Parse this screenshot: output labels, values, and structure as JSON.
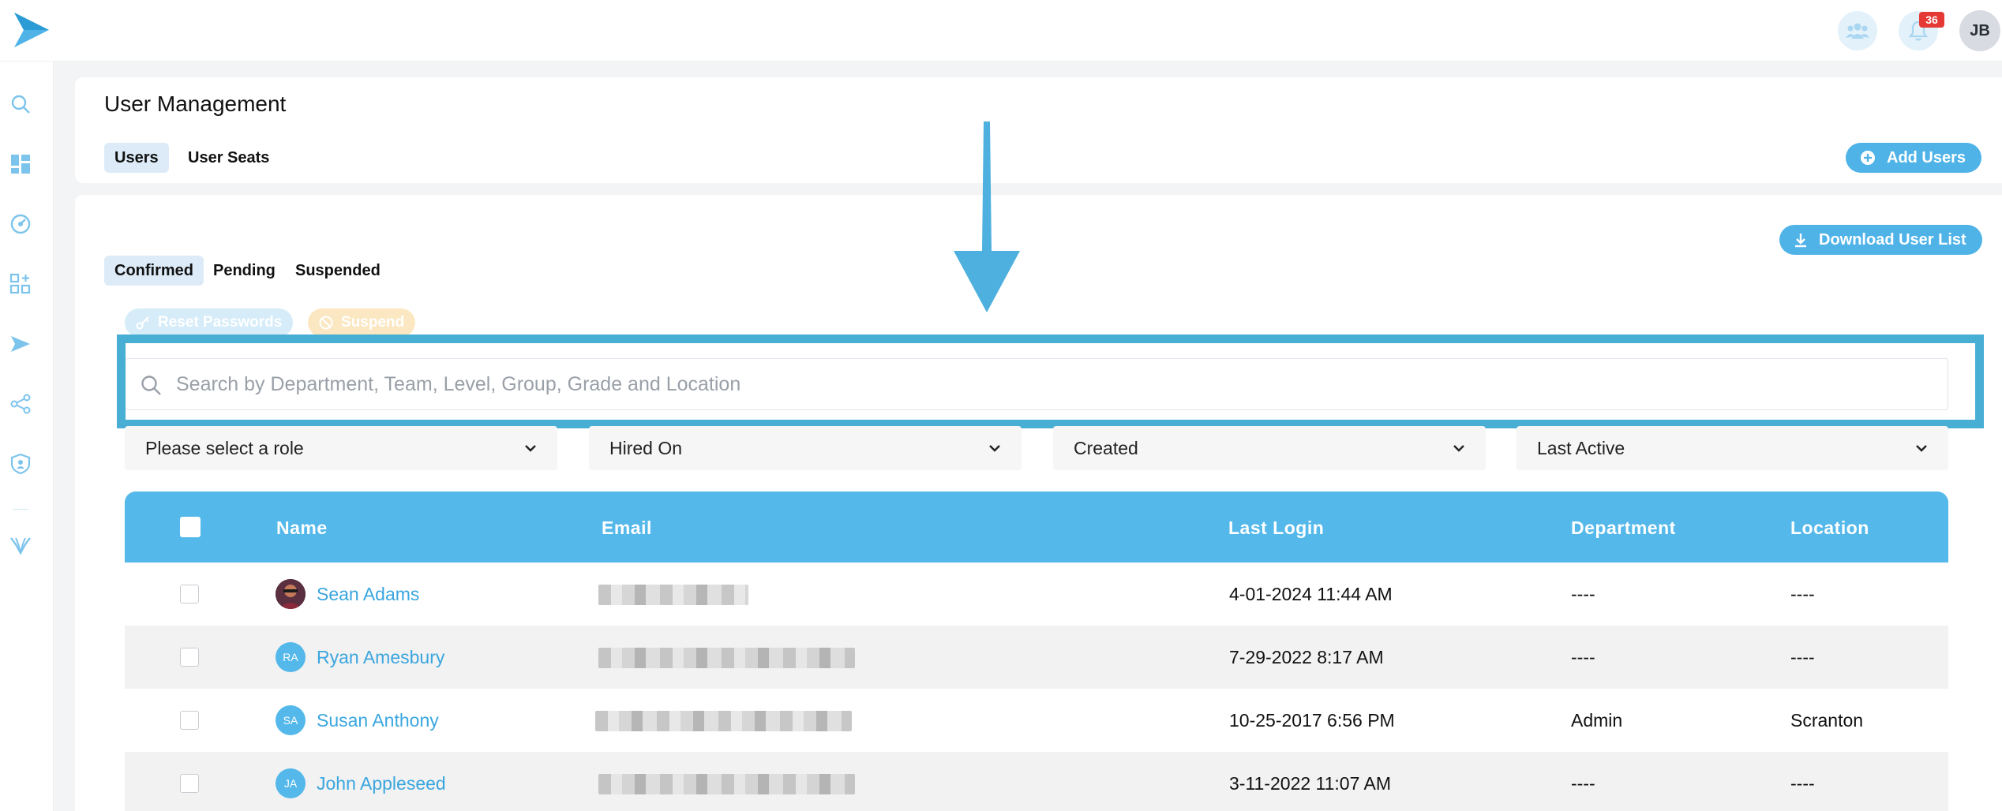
{
  "header": {
    "notification_count": "36",
    "avatar_initials": "JB"
  },
  "page": {
    "title": "User Management",
    "tabs": [
      {
        "label": "Users",
        "active": true
      },
      {
        "label": "User Seats",
        "active": false
      }
    ],
    "add_users_label": "Add Users"
  },
  "main": {
    "download_label": "Download User List",
    "status_tabs": [
      {
        "label": "Confirmed",
        "active": true
      },
      {
        "label": "Pending",
        "active": false
      },
      {
        "label": "Suspended",
        "active": false
      }
    ],
    "bulk_actions": {
      "reset_label": "Reset Passwords",
      "suspend_label": "Suspend"
    },
    "search": {
      "placeholder": "Search by Department, Team, Level, Group, Grade and Location",
      "value": ""
    },
    "filters": [
      {
        "label": "Please select a role"
      },
      {
        "label": "Hired On"
      },
      {
        "label": "Created"
      },
      {
        "label": "Last Active"
      }
    ]
  },
  "table": {
    "columns": [
      "Name",
      "Email",
      "Last Login",
      "Department",
      "Location"
    ],
    "rows": [
      {
        "initials": "",
        "photo": true,
        "name": "Sean Adams",
        "last_login": "4-01-2024 11:44 AM",
        "department": "----",
        "location": "----"
      },
      {
        "initials": "RA",
        "photo": false,
        "name": "Ryan Amesbury",
        "last_login": "7-29-2022 8:17 AM",
        "department": "----",
        "location": "----"
      },
      {
        "initials": "SA",
        "photo": false,
        "name": "Susan Anthony",
        "last_login": "10-25-2017 6:56 PM",
        "department": "Admin",
        "location": "Scranton"
      },
      {
        "initials": "JA",
        "photo": false,
        "name": "John Appleseed",
        "last_login": "3-11-2022 11:07 AM",
        "department": "----",
        "location": "----"
      }
    ]
  },
  "colors": {
    "accent": "#54b8ea",
    "link": "#3aa6df",
    "highlight": "#48aed4",
    "badge": "#e53935"
  }
}
